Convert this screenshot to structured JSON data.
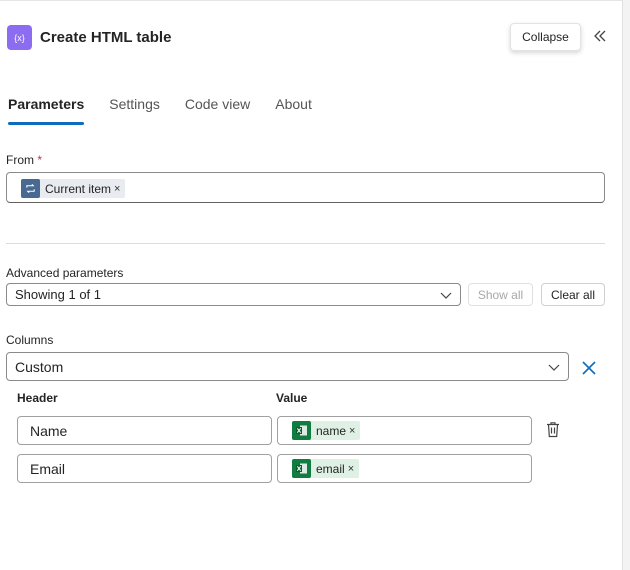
{
  "header": {
    "title": "Create HTML table",
    "icon_glyph": "{x}",
    "collapse_label": "Collapse"
  },
  "tabs": [
    {
      "label": "Parameters",
      "active": true
    },
    {
      "label": "Settings",
      "active": false
    },
    {
      "label": "Code view",
      "active": false
    },
    {
      "label": "About",
      "active": false
    }
  ],
  "from": {
    "label": "From",
    "required_mark": "*",
    "token": {
      "label": "Current item",
      "remove": "×",
      "icon": "loop-icon"
    }
  },
  "advanced": {
    "label": "Advanced parameters",
    "value": "Showing 1 of 1",
    "show_all": "Show all",
    "clear_all": "Clear all"
  },
  "columns": {
    "label": "Columns",
    "value": "Custom",
    "header_label": "Header",
    "value_label": "Value",
    "rows": [
      {
        "header": "Name",
        "token": "name",
        "remove": "×"
      },
      {
        "header": "Email",
        "token": "email",
        "remove": "×"
      }
    ]
  },
  "colors": {
    "accent": "#0f6cbd",
    "action_icon": "#8c6cf0",
    "excel": "#107c41",
    "loop": "#486991",
    "required": "#c4314b"
  }
}
